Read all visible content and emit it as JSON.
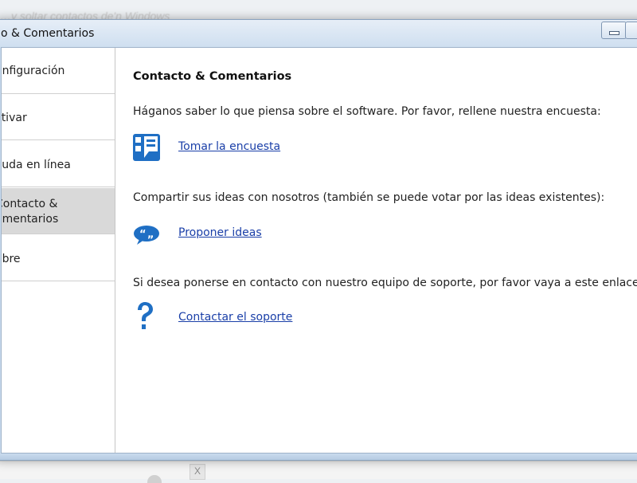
{
  "background_text": "…y soltar contactos de'n Windows",
  "window": {
    "title": "o & Comentarios"
  },
  "sidebar": {
    "items": [
      {
        "label": "onfiguración"
      },
      {
        "label": "ctivar"
      },
      {
        "label": "yuda en línea"
      },
      {
        "label_line1": "Contacto &",
        "label_line2": "omentarios",
        "active": true
      },
      {
        "label": "obre"
      }
    ]
  },
  "main": {
    "heading": "Contacto & Comentarios",
    "survey_text": "Háganos saber lo que piensa sobre el software. Por favor, rellene nuestra encuesta:",
    "survey_link": "Tomar la encuesta",
    "ideas_text": "Compartir sus ideas con nosotros (también se puede votar por las ideas existentes):",
    "ideas_link": "Proponer ideas",
    "support_text": "Si desea ponerse en contacto con nuestro equipo de soporte, por favor vaya a este enlace:",
    "support_link": "Contactar el soporte"
  },
  "taskbar": {
    "close_glyph": "X"
  },
  "icons": {
    "survey": "survey-icon",
    "ideas": "speech-bubble-quotes-icon",
    "support": "question-mark-icon"
  },
  "colors": {
    "link": "#1a3fa8",
    "icon_blue": "#1f6fc4",
    "active_nav": "#d9d9d9"
  }
}
